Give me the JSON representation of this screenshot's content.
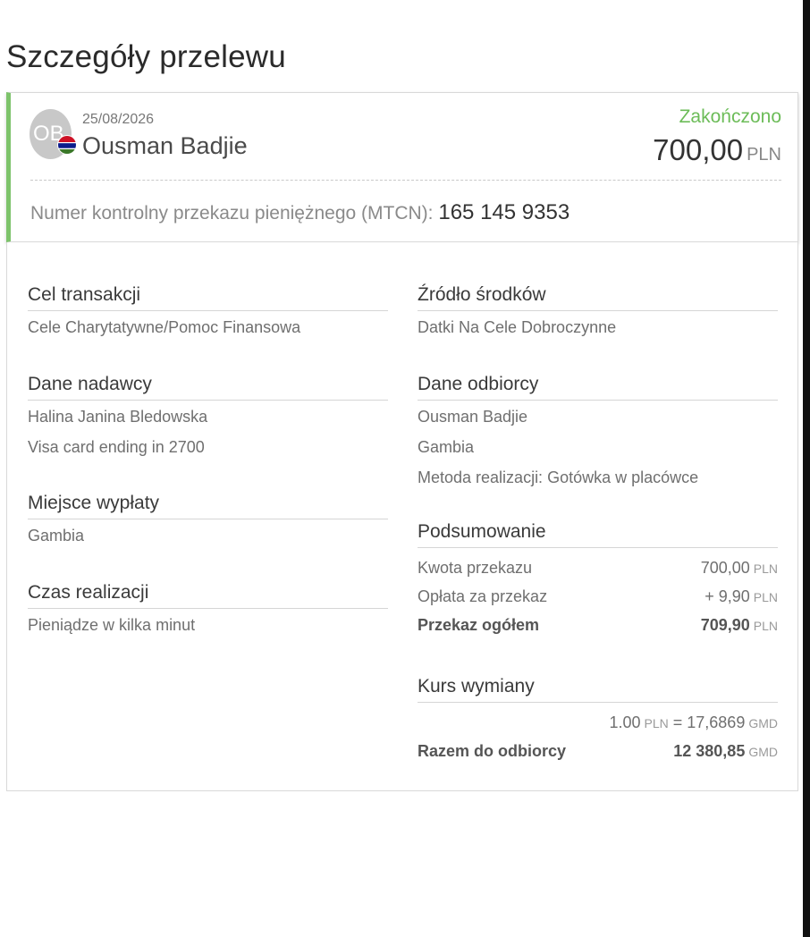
{
  "page": {
    "title": "Szczegóły przelewu"
  },
  "header": {
    "avatar_initials": "OB",
    "date": "25/08/2026",
    "recipient_name": "Ousman Badjie",
    "status": "Zakończono",
    "status_color": "#6cbc58",
    "amount": "700,00",
    "currency": "PLN",
    "mtcn_label": "Numer kontrolny przekazu pieniężnego (MTCN):",
    "mtcn_value": "165 145 9353",
    "flag_icon": "gambia-flag-icon"
  },
  "details": {
    "purpose": {
      "title": "Cel transakcji",
      "value": "Cele Charytatywne/Pomoc Finansowa"
    },
    "source": {
      "title": "Źródło środków",
      "value": "Datki Na Cele Dobroczynne"
    },
    "sender": {
      "title": "Dane nadawcy",
      "name": "Halina Janina Bledowska",
      "card": "Visa card ending in 2700"
    },
    "receiver": {
      "title": "Dane odbiorcy",
      "name": "Ousman Badjie",
      "country": "Gambia",
      "method": "Metoda realizacji: Gotówka w placówce"
    },
    "payout": {
      "title": "Miejsce wypłaty",
      "value": "Gambia"
    },
    "delivery": {
      "title": "Czas realizacji",
      "value": "Pieniądze w kilka minut"
    },
    "summary": {
      "title": "Podsumowanie",
      "transfer_label": "Kwota przekazu",
      "transfer_amount": "700,00",
      "fee_label": "Opłata za przekaz",
      "fee_amount": "+ 9,90",
      "total_label": "Przekaz ogółem",
      "total_amount": "709,90",
      "currency": "PLN"
    },
    "exchange": {
      "title": "Kurs wymiany",
      "rate_from": "1.00",
      "rate_from_currency": "PLN",
      "rate_eq": "= 17,6869",
      "rate_to_currency": "GMD",
      "recipient_label": "Razem do odbiorcy",
      "recipient_amount": "12 380,85",
      "recipient_currency": "GMD"
    }
  }
}
